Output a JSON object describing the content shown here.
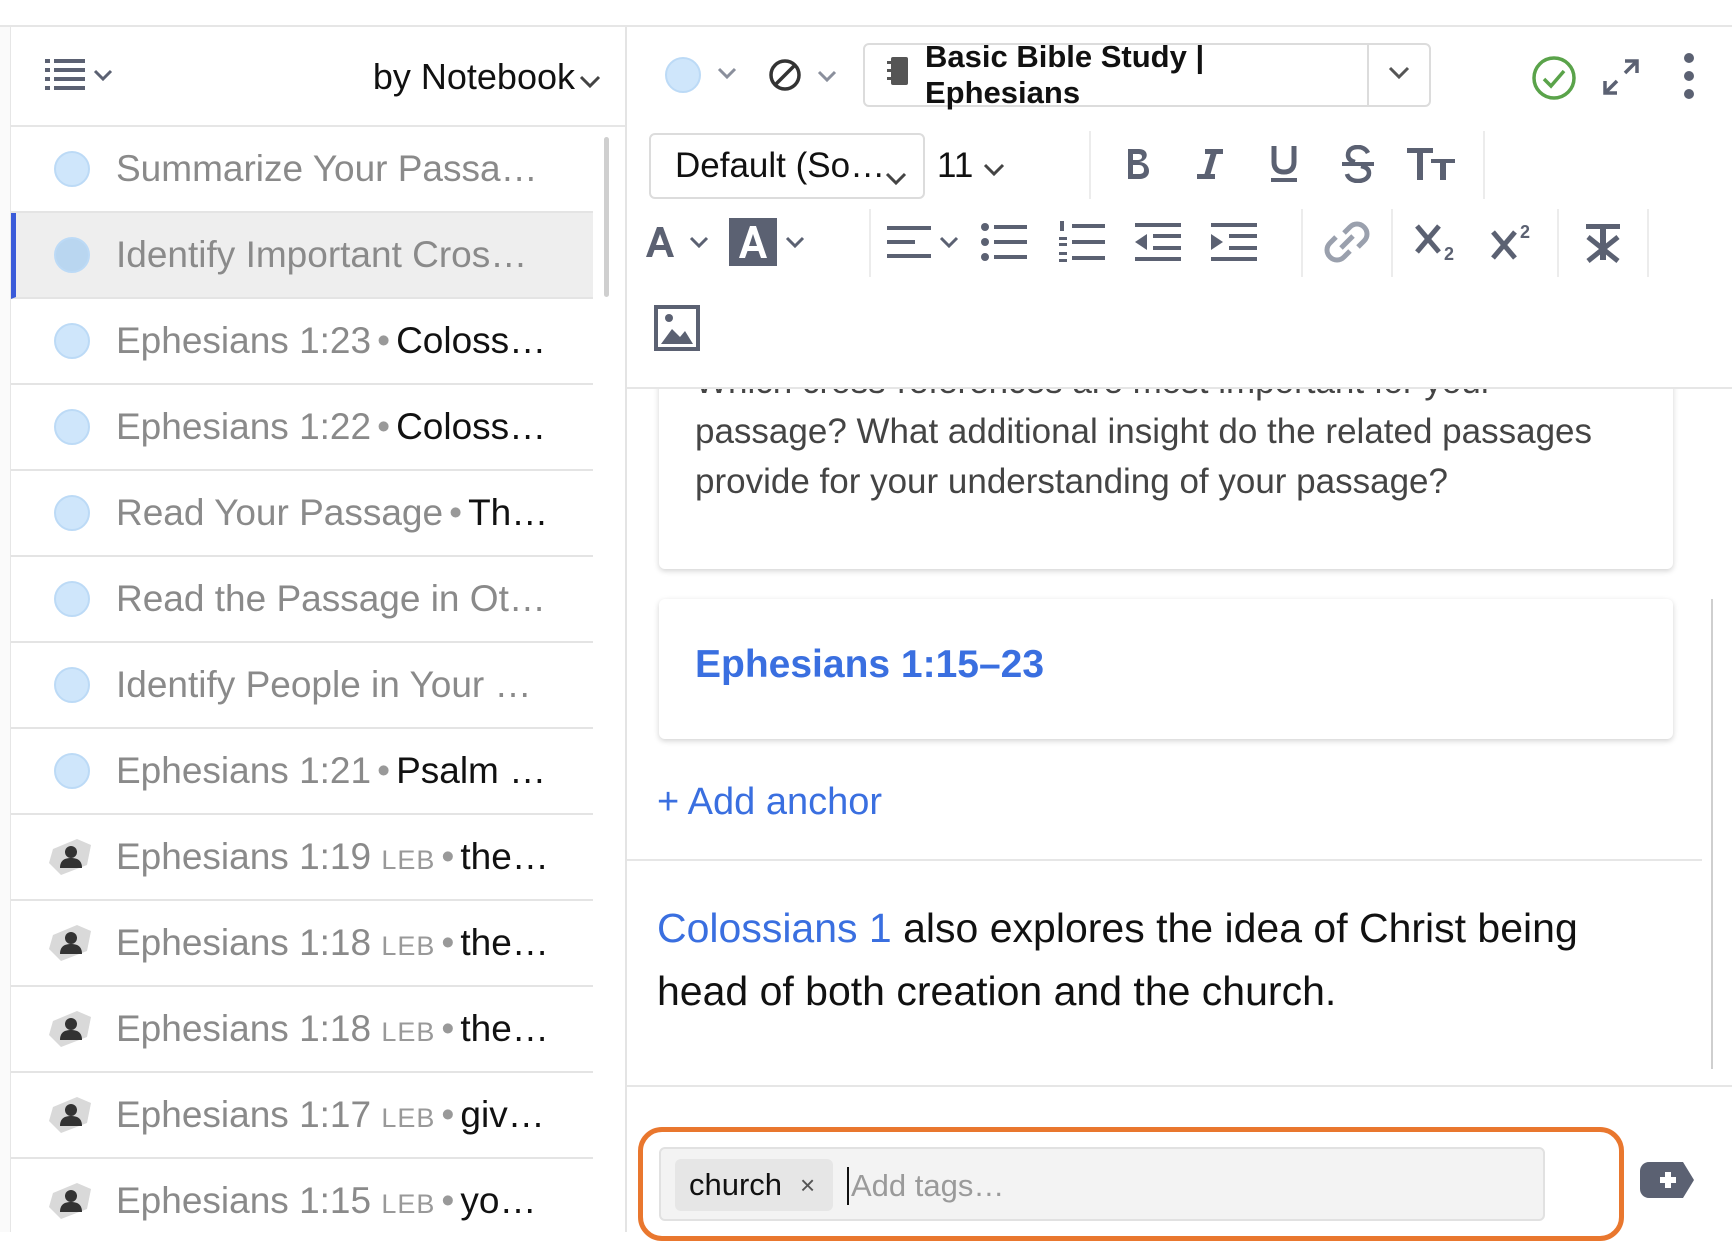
{
  "sidebar": {
    "sort_label": "by Notebook",
    "items": [
      {
        "type": "dot",
        "label": "Summarize Your Passag…",
        "ref": "",
        "version": "",
        "text": ""
      },
      {
        "type": "dot",
        "label": "Identify Important Cros…",
        "ref": "",
        "version": "",
        "text": "",
        "selected": true
      },
      {
        "type": "dot",
        "label": "",
        "ref": "Ephesians 1:23",
        "version": "",
        "text": "Coloss…"
      },
      {
        "type": "dot",
        "label": "",
        "ref": "Ephesians 1:22",
        "version": "",
        "text": "Coloss…"
      },
      {
        "type": "dot",
        "label": "",
        "ref": "Read Your Passage",
        "version": "",
        "text": "Th…"
      },
      {
        "type": "dot",
        "label": "Read the Passage in Oth…",
        "ref": "",
        "version": "",
        "text": ""
      },
      {
        "type": "dot",
        "label": "Identify People in Your …",
        "ref": "",
        "version": "",
        "text": ""
      },
      {
        "type": "dot",
        "label": "",
        "ref": "Ephesians 1:21",
        "version": "",
        "text": "Psalm …"
      },
      {
        "type": "highlight",
        "label": "",
        "ref": "Ephesians 1:19",
        "version": "LEB",
        "text": "the…"
      },
      {
        "type": "highlight",
        "label": "",
        "ref": "Ephesians 1:18",
        "version": "LEB",
        "text": "the…"
      },
      {
        "type": "highlight",
        "label": "",
        "ref": "Ephesians 1:18",
        "version": "LEB",
        "text": "the…"
      },
      {
        "type": "highlight",
        "label": "",
        "ref": "Ephesians 1:17",
        "version": "LEB",
        "text": "giv…"
      },
      {
        "type": "highlight",
        "label": "",
        "ref": "Ephesians 1:15",
        "version": "LEB",
        "text": "yo…"
      }
    ]
  },
  "header": {
    "notebook_title": "Basic Bible Study | Ephesians"
  },
  "toolbar": {
    "font_family": "Default (So…",
    "font_size": "11"
  },
  "note": {
    "question": "Which cross-references are most important for your passage? What additional insight do the related passages provide for your understanding of your passage?",
    "anchor_ref": "Ephesians 1:15–23",
    "add_anchor_label": "+ Add anchor",
    "body_link": "Colossians 1",
    "body_text": " also explores the idea of Christ being head of both creation and the church."
  },
  "tags": {
    "items": [
      "church"
    ],
    "remove_glyph": "×",
    "placeholder": "Add tags…"
  },
  "colors": {
    "accent_blue": "#3a6fe0",
    "selection_bar": "#3a5bd9",
    "dot_fill": "#cfe6fb",
    "check_green": "#5aa34a",
    "highlight_outline": "#e9772e"
  }
}
